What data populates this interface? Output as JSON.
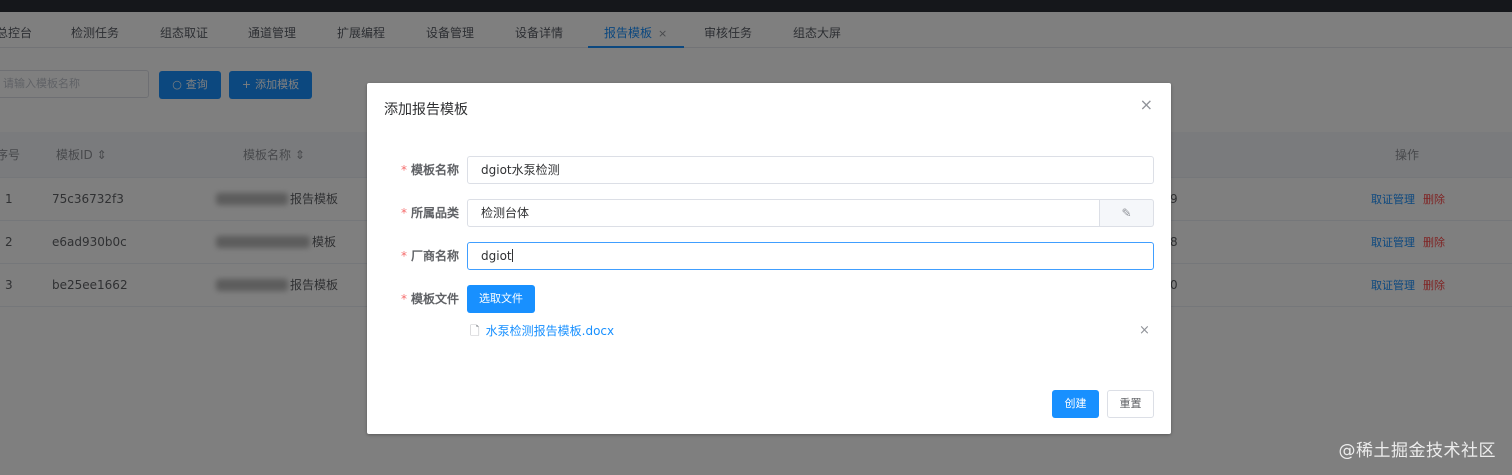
{
  "tabs": [
    {
      "label": "总控台"
    },
    {
      "label": "检测任务"
    },
    {
      "label": "组态取证"
    },
    {
      "label": "通道管理"
    },
    {
      "label": "扩展编程"
    },
    {
      "label": "设备管理"
    },
    {
      "label": "设备详情"
    },
    {
      "label": "报告模板",
      "active": true,
      "close": "×"
    },
    {
      "label": "审核任务"
    },
    {
      "label": "组态大屏"
    }
  ],
  "toolbar": {
    "search_placeholder": "请输入模板名称",
    "query_label": "查询",
    "add_label": "添加模板",
    "query_icon": "search-icon",
    "add_icon": "plus-icon"
  },
  "table": {
    "headers": [
      "序号",
      "模板ID",
      "模板名称",
      "操作"
    ],
    "sort_icon": "⇕",
    "rows": [
      {
        "index": "1",
        "id": "75c36732f3",
        "name_tail": "报告模板",
        "extra": "9",
        "action_manage": "取证管理",
        "action_delete": "删除"
      },
      {
        "index": "2",
        "id": "e6ad930b0c",
        "name_tail": "模板",
        "extra": "8",
        "action_manage": "取证管理",
        "action_delete": "删除"
      },
      {
        "index": "3",
        "id": "be25ee1662",
        "name_tail": "报告模板",
        "extra": "0",
        "action_manage": "取证管理",
        "action_delete": "删除"
      }
    ]
  },
  "dialog": {
    "title": "添加报告模板",
    "close": "×",
    "fields": {
      "template_name": {
        "label": "模板名称",
        "value": "dgiot水泵检测"
      },
      "category": {
        "label": "所属品类",
        "value": "检测台体",
        "append_icon": "edit-icon",
        "append_glyph": "✎"
      },
      "vendor": {
        "label": "厂商名称",
        "value": "dgiot"
      },
      "file": {
        "label": "模板文件",
        "button": "选取文件",
        "file_name": "水泵检测报告模板.docx",
        "remove": "×"
      }
    },
    "required_mark": "*",
    "create_label": "创建",
    "reset_label": "重置"
  },
  "watermark": "@稀土掘金技术社区",
  "colors": {
    "primary": "#1890ff",
    "danger": "#ff4949",
    "required": "#f56c6c",
    "overlay": "rgba(0,0,0,0.5)"
  }
}
